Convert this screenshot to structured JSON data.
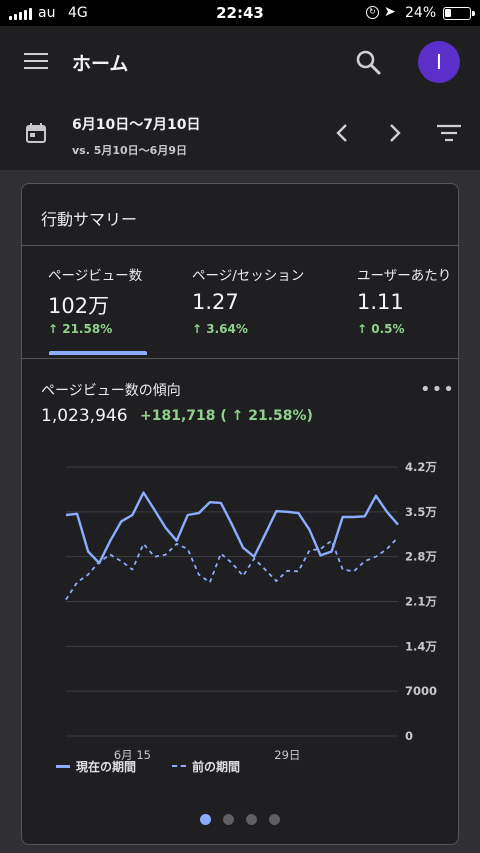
{
  "status_bar": {
    "carrier": "au",
    "network": "4G",
    "time": "22:43",
    "battery_pct": "24%"
  },
  "app_bar": {
    "menu_icon": "hamburger-menu-icon",
    "title": "ホーム",
    "search_icon": "search-icon",
    "avatar_initial": "I"
  },
  "date_bar": {
    "calendar_icon": "calendar-icon",
    "range": "6月10日〜7月10日",
    "compare": "vs. 5月10日〜6月9日",
    "prev_icon": "chevron-left-icon",
    "next_icon": "chevron-right-icon",
    "filter_icon": "filter-icon"
  },
  "summary_card": {
    "title": "行動サマリー",
    "metrics": [
      {
        "label": "ページビュー数",
        "value": "102万",
        "change": "↑ 21.58%"
      },
      {
        "label": "ページ/セッション",
        "value": "1.27",
        "change": "↑ 3.64%"
      },
      {
        "label": "ユーザーあたり",
        "value": "1.11",
        "change": "↑ 0.5%"
      }
    ],
    "trend": {
      "title": "ページビュー数の傾向",
      "total": "1,023,946",
      "delta": "+181,718 ( ↑ 21.58%)",
      "more_icon": "more-horizontal-icon"
    },
    "legend": {
      "current": "現在の期間",
      "previous": "前の期間"
    },
    "pages": {
      "count": 4,
      "active": 0
    }
  },
  "colors": {
    "current_series": "#8cadff",
    "previous_series": "#8cadff",
    "positive_change": "#8fd18c",
    "avatar": "#5b2fc9"
  },
  "chart_data": {
    "type": "line",
    "x_tick_labels": [
      "6月 15",
      "29日"
    ],
    "y_tick_labels": [
      "4.2万",
      "3.5万",
      "2.8万",
      "2.1万",
      "1.4万",
      "7000",
      "0"
    ],
    "ylim": [
      0,
      42000
    ],
    "y_ticks": [
      42000,
      35000,
      28000,
      21000,
      14000,
      7000,
      0
    ],
    "x_ticks": [
      6,
      20
    ],
    "grid": true,
    "legend_placement": "bottom-left",
    "series": [
      {
        "name": "現在の期間",
        "style": "solid",
        "values": [
          34500,
          34700,
          28800,
          27000,
          30500,
          33500,
          34500,
          38000,
          35300,
          32500,
          30500,
          34500,
          34800,
          36500,
          36400,
          33000,
          29400,
          28000,
          31500,
          35100,
          35000,
          34800,
          32200,
          28200,
          28800,
          34200,
          34200,
          34300,
          37500,
          35000,
          33000
        ]
      },
      {
        "name": "前の期間",
        "style": "dashed",
        "values": [
          21300,
          24000,
          25200,
          27200,
          28300,
          27300,
          26000,
          30000,
          28000,
          28300,
          30000,
          29200,
          25200,
          24000,
          28500,
          27000,
          25000,
          27700,
          26000,
          24200,
          25800,
          25700,
          29000,
          29200,
          30500,
          26000,
          25700,
          27300,
          28000,
          29200,
          31000
        ]
      }
    ]
  }
}
